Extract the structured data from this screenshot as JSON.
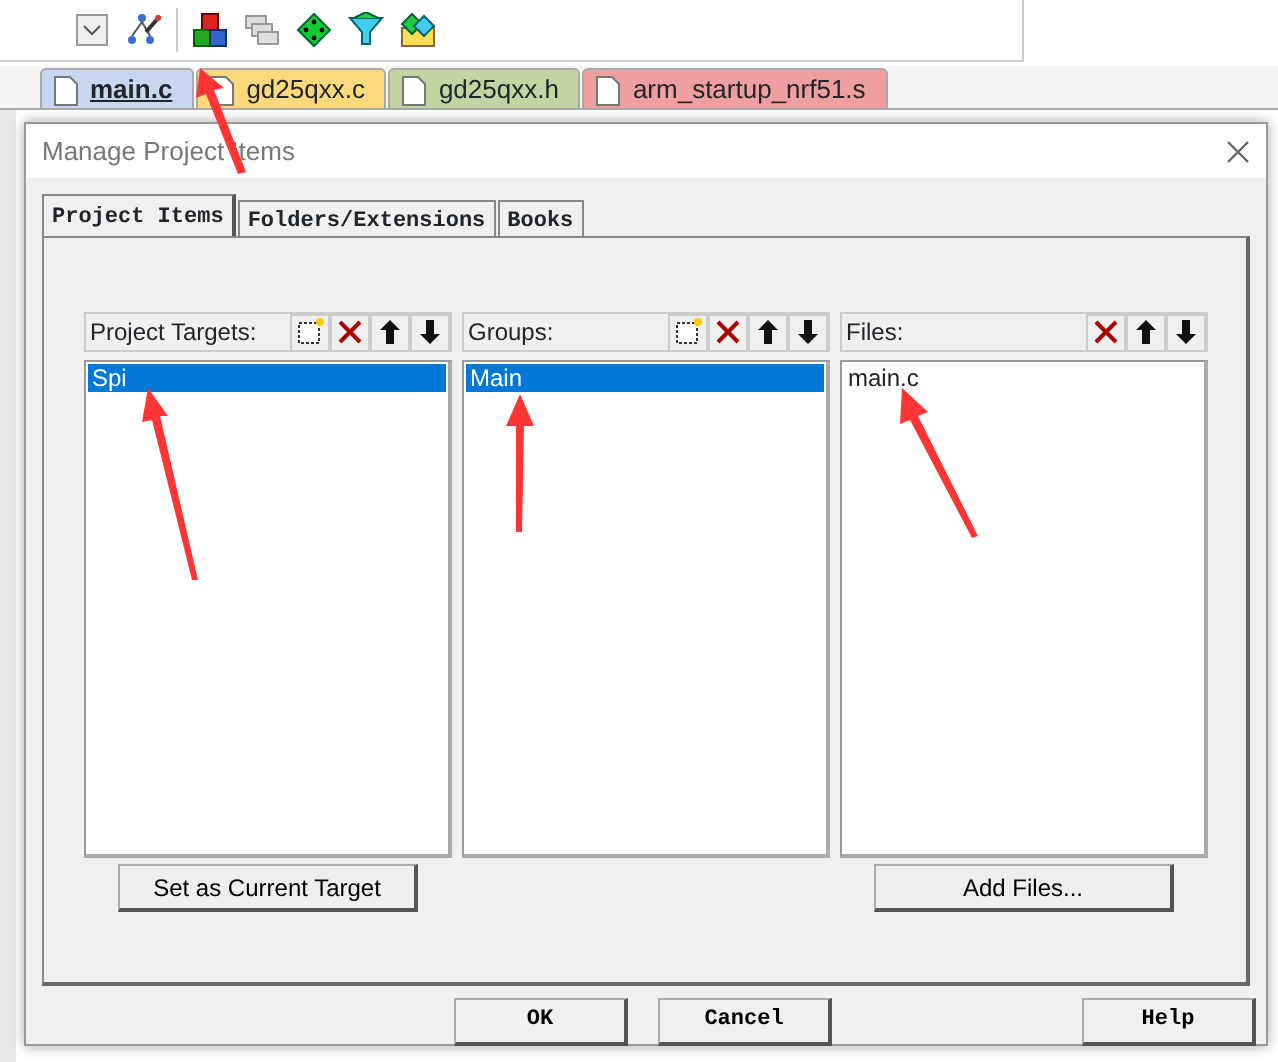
{
  "editor_tabs": [
    {
      "label": "main.c",
      "selected": true,
      "color": "#c9d6f0"
    },
    {
      "label": "gd25qxx.c",
      "selected": false,
      "color": "#fcd97c"
    },
    {
      "label": "gd25qxx.h",
      "selected": false,
      "color": "#c3d3a2"
    },
    {
      "label": "arm_startup_nrf51.s",
      "selected": false,
      "color": "#ef9f9f"
    }
  ],
  "dialog": {
    "title": "Manage Project Items",
    "tabs": [
      {
        "label": "Project Items",
        "selected": true
      },
      {
        "label": "Folders/Extensions",
        "selected": false
      },
      {
        "label": "Books",
        "selected": false
      }
    ],
    "panels": [
      {
        "title": "Project Targets:",
        "tools": [
          {
            "kind": "new"
          },
          {
            "kind": "delete"
          },
          {
            "kind": "up"
          },
          {
            "kind": "down"
          }
        ],
        "items": [
          {
            "label": "Spi",
            "selected": true
          }
        ],
        "button": "Set as Current Target"
      },
      {
        "title": "Groups:",
        "tools": [
          {
            "kind": "new"
          },
          {
            "kind": "delete"
          },
          {
            "kind": "up"
          },
          {
            "kind": "down"
          }
        ],
        "items": [
          {
            "label": "Main",
            "selected": true
          }
        ]
      },
      {
        "title": "Files:",
        "tools": [
          {
            "kind": "delete"
          },
          {
            "kind": "up"
          },
          {
            "kind": "down"
          }
        ],
        "items": [
          {
            "label": "main.c",
            "selected": false
          }
        ],
        "button": "Add Files..."
      }
    ],
    "buttons": [
      {
        "label": "OK",
        "kind": "ok"
      },
      {
        "label": "Cancel",
        "kind": "cancel"
      },
      {
        "label": "Help",
        "kind": "help"
      }
    ]
  }
}
